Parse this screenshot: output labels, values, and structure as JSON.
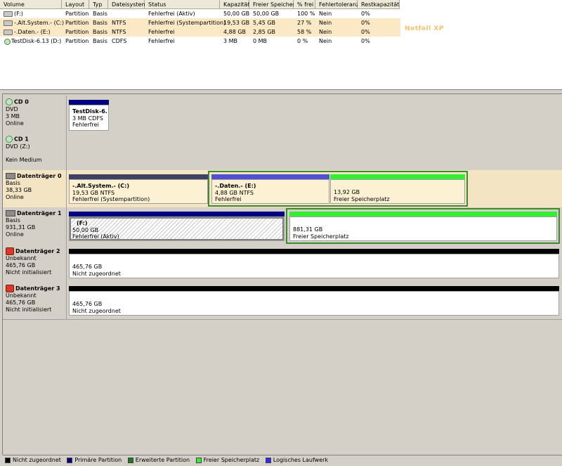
{
  "columns": [
    "Volume",
    "Layout",
    "Typ",
    "Dateisystem",
    "Status",
    "Kapazität",
    "Freier Speicher",
    "% frei",
    "Fehlertoleranz",
    "Restkapazität"
  ],
  "volumes": [
    {
      "volume": "(F:)",
      "layout": "Partition",
      "typ": "Basis",
      "fs": "",
      "status": "Fehlerfrei (Aktiv)",
      "kapazitaet": "50,00 GB",
      "frei": "50,00 GB",
      "pct": "100 %",
      "fehlertoleranz": "Nein",
      "rest": "0%"
    },
    {
      "volume": "-.Alt.System.- (C:)",
      "layout": "Partition",
      "typ": "Basis",
      "fs": "NTFS",
      "status": "Fehlerfrei (Systempartition)",
      "kapazitaet": "19,53 GB",
      "frei": "5,45 GB",
      "pct": "27 %",
      "fehlertoleranz": "Nein",
      "rest": "0%"
    },
    {
      "volume": "-.Daten.- (E:)",
      "layout": "Partition",
      "typ": "Basis",
      "fs": "NTFS",
      "status": "Fehlerfrei",
      "kapazitaet": "4,88 GB",
      "frei": "2,85 GB",
      "pct": "58 %",
      "fehlertoleranz": "Nein",
      "rest": "0%"
    },
    {
      "volume": "TestDisk-6.13 (D:)",
      "layout": "Partition",
      "typ": "Basis",
      "fs": "CDFS",
      "status": "Fehlerfrei",
      "kapazitaet": "3 MB",
      "frei": "0 MB",
      "pct": "0 %",
      "fehlertoleranz": "Nein",
      "rest": "0%"
    }
  ],
  "annotation": "Notfall XP",
  "disks": {
    "cd0": {
      "name": "CD 0",
      "l1": "DVD",
      "l2": "3 MB",
      "l3": "Online"
    },
    "cd1": {
      "name": "CD 1",
      "l1": "DVD (Z:)",
      "l2": "",
      "l3": "Kein Medium"
    },
    "d0": {
      "name": "Datenträger 0",
      "l1": "Basis",
      "l2": "38,33 GB",
      "l3": "Online"
    },
    "d1": {
      "name": "Datenträger 1",
      "l1": "Basis",
      "l2": "931,31 GB",
      "l3": "Online"
    },
    "d2": {
      "name": "Datenträger 2",
      "l1": "Unbekannt",
      "l2": "465,76 GB",
      "l3": "Nicht initialisiert"
    },
    "d3": {
      "name": "Datenträger 3",
      "l1": "Unbekannt",
      "l2": "465,76 GB",
      "l3": "Nicht initialisiert"
    }
  },
  "partitions": {
    "cd0_p": {
      "title": "TestDisk-6.",
      "l1": "3 MB CDFS",
      "l2": "Fehlerfrei"
    },
    "d0_c": {
      "title": "-.Alt.System.-  (C:)",
      "l1": "19,53 GB NTFS",
      "l2": "Fehlerfrei (Systempartition)"
    },
    "d0_e": {
      "title": "-.Daten.-  (E:)",
      "l1": "4,88 GB NTFS",
      "l2": "Fehlerfrei"
    },
    "d0_free": {
      "title": "",
      "l1": "13,92 GB",
      "l2": "Freier Speicherplatz"
    },
    "d1_f": {
      "title": "(F:)",
      "l1": "50,00 GB",
      "l2": "Fehlerfrei (Aktiv)"
    },
    "d1_free": {
      "title": "",
      "l1": "881,31 GB",
      "l2": "Freier Speicherplatz"
    },
    "d2_p": {
      "title": "",
      "l1": "465,76 GB",
      "l2": "Nicht zugeordnet"
    },
    "d3_p": {
      "title": "",
      "l1": "465,76 GB",
      "l2": "Nicht zugeordnet"
    }
  },
  "legend": [
    {
      "label": "Nicht zugeordnet",
      "color": "#000000"
    },
    {
      "label": "Primäre Partition",
      "color": "#000080"
    },
    {
      "label": "Erweiterte Partition",
      "color": "#1f7a1f"
    },
    {
      "label": "Freier Speicherplatz",
      "color": "#33ee33"
    },
    {
      "label": "Logisches Laufwerk",
      "color": "#2a2aff"
    }
  ],
  "colors": {
    "primary": "#000080",
    "logical": "#5050d0",
    "free": "#33ee33",
    "unallocated": "#000000",
    "system_logical": "#404060"
  }
}
